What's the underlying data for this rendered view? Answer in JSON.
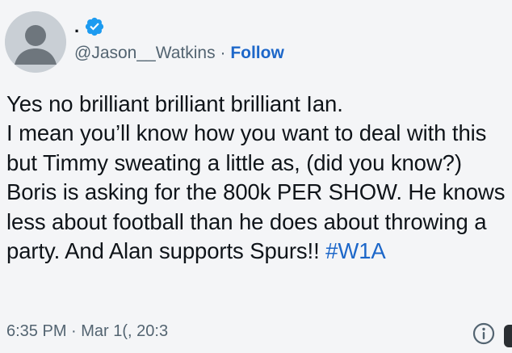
{
  "author": {
    "display_name": ".",
    "handle": "@Jason__Watkins",
    "separator": "·",
    "follow_label": "Follow",
    "verified_icon": "verified-badge-icon",
    "verified_color": "#1d9bf0"
  },
  "tweet": {
    "text": "Yes no brilliant brilliant brilliant Ian.\nI mean you’ll know how you want to deal with this but Timmy sweating a little as, (did you know?) Boris is asking for the 800k PER SHOW. He knows less about football than he does about throwing a party. And Alan supports Spurs!! ",
    "hashtag": "#W1A",
    "timestamp": "6:35 PM · Mar 1⁠(, 20⁠:3"
  },
  "icons": {
    "info": "info-icon",
    "avatar": "default-avatar-icon"
  },
  "colors": {
    "link": "#1d67c9",
    "text": "#0f1419",
    "muted": "#536471",
    "background": "#f4f5f7"
  }
}
